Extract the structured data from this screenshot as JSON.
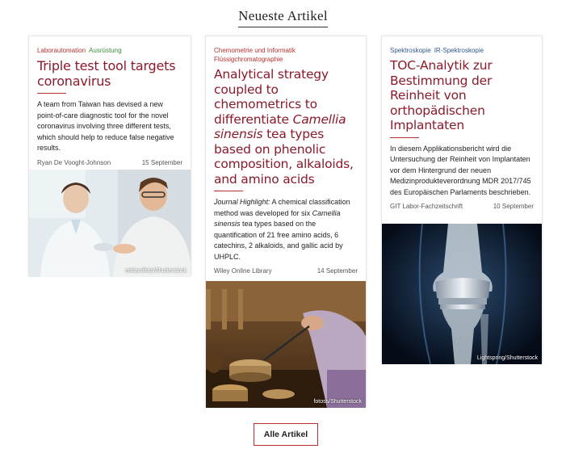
{
  "section": {
    "heading": "Neueste Artikel"
  },
  "articles": [
    {
      "categories": [
        "Laborautomation",
        "Ausrüstung"
      ],
      "title": "Triple test tool targets coronavirus",
      "description": "A team from Taiwan has devised a new point-of-care diagnostic tool for the novel coronavirus involving three different tests, which should help to reduce false negative results.",
      "author": "Ryan De Vooght-Johnson",
      "date": "15 September",
      "image_credit": "edriandfoto/Shutterstock"
    },
    {
      "categories": [
        "Chemometrie und Informatik",
        "Flüssigchromatographie"
      ],
      "title_pre": "Analytical strategy coupled to chemometrics to differentiate ",
      "title_em": "Camellia sinensis",
      "title_post": " tea types based on phenolic composition, alkaloids, and amino acids",
      "description_em": "Journal Highlight:",
      "description_pre": " A chemical classification method was developed for six ",
      "description_em2": "Camellia sinensis",
      "description_post": " tea types based on the quantification of 21 free amino acids, 6 catechins, 2 alkaloids, and gallic acid by UHPLC.",
      "author": "Wiley Online Library",
      "date": "14 September",
      "image_credit": "fotoss/Shutterstock"
    },
    {
      "categories": [
        "Spektroskopie",
        "IR-Spektroskopie"
      ],
      "title": "TOC-Analytik zur Bestimmung der Reinheit von orthopädischen Implantaten",
      "description": "In diesem Applikationsbericht wird die Untersuchung der Reinheit von Implantaten vor dem Hintergrund der neuen Medizinprodukteverordnung MDR 2017/745 des Europäischen Parlaments beschrieben.",
      "author": "GIT Labor-Fachzeitschrift",
      "date": "10 September",
      "image_credit": "Lightspring/Shutterstock"
    }
  ],
  "all_articles_button": "Alle Artikel",
  "colors": {
    "accent": "#b5302e",
    "title": "#8b1a2b",
    "category_alt": "#3a8a3a",
    "category_blue": "#2d5a8c"
  }
}
